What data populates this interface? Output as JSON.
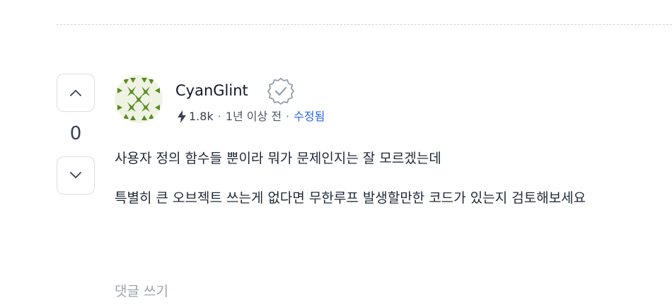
{
  "answer": {
    "votes": {
      "count": "0",
      "up_icon": "chevron-up-icon",
      "down_icon": "chevron-down-icon"
    },
    "author": {
      "name": "CyanGlint",
      "verified_icon": "verified-badge-icon",
      "reputation_icon": "bolt-icon",
      "reputation": "1.8k",
      "time": "1년 이상 전",
      "edited_label": "수정됨",
      "separator": "·"
    },
    "body": {
      "paragraphs": [
        "사용자 정의 함수들 뿐이라 뭐가 문제인지는 잘 모르겠는데",
        "특별히 큰 오브젝트 쓰는게 없다면 무한루프 발생할만한 코드가 있는지 검토해보세요"
      ]
    },
    "comment_link": "댓글 쓰기"
  },
  "colors": {
    "link": "#2563eb",
    "avatar_green": "#5a8a1f",
    "muted": "#9ca3af"
  }
}
